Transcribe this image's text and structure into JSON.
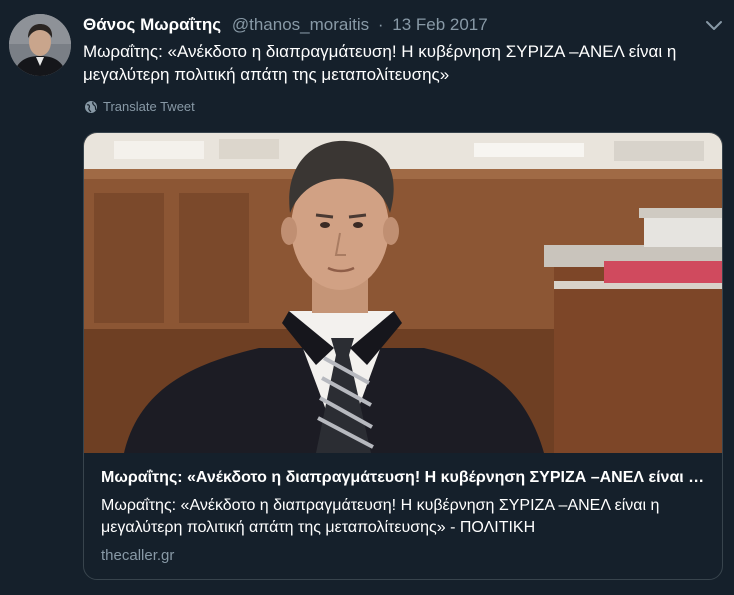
{
  "tweet": {
    "author_name": "Θάνος Μωραΐτης",
    "handle": "@thanos_moraitis",
    "separator": "·",
    "date": "13 Feb 2017",
    "text": "Μωραΐτης: «Ανέκδοτο η διαπραγμάτευση! Η κυβέρνηση ΣΥΡΙΖΑ –ΑΝΕΛ είναι η μεγαλύτερη πολιτική απάτη της μεταπολίτευσης»",
    "translate_label": "Translate Tweet",
    "avatar_icon": "user-avatar",
    "caret_icon": "chevron-down-icon"
  },
  "card": {
    "title": "Μωραΐτης: «Ανέκδοτο η διαπραγμάτευση! Η κυβέρνηση ΣΥΡΙΖΑ –ΑΝΕΛ είναι η μεγαλύτερη πολιτική απάτη της μεταπολίτευσης»",
    "description": "Μωραΐτης: «Ανέκδοτο η διαπραγμάτευση! Η κυβέρνηση ΣΥΡΙΖΑ –ΑΝΕΛ είναι η μεγαλύτερη πολιτική απάτη της μεταπολίτευσης» - ΠΟΛΙΤΙΚΗ",
    "domain": "thecaller.gr"
  },
  "colors": {
    "background": "#15202b",
    "secondary_text": "#8899a6",
    "border": "#38444d",
    "primary_text": "#ffffff"
  }
}
